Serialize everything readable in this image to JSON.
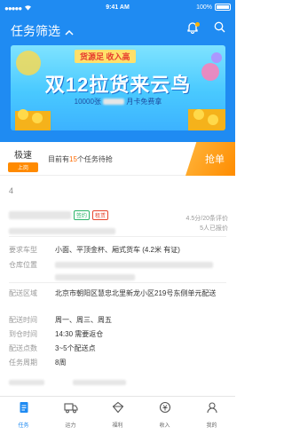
{
  "status_bar": {
    "time": "9:41 AM",
    "battery": "100%"
  },
  "header": {
    "title": "任务筛选"
  },
  "banner": {
    "tag": "货源足 收入高",
    "headline": "双12拉货来云鸟",
    "sub_left": "10000张",
    "sub_right": "月卡免费拿"
  },
  "notice": {
    "speed_title": "极速",
    "speed_tag": "上岗",
    "text_prefix": "目前有",
    "count": "15",
    "text_suffix": "个任务待抢",
    "grab_button": "抢单"
  },
  "list_count": "4",
  "task": {
    "tags": [
      "签约",
      "租赁"
    ],
    "rating_line": "4.5分/20条评价",
    "quote_line": "5人已报价",
    "rows": [
      {
        "label": "要求车型",
        "value": "小面、平顶金杯、厢式货车 (4.2米 有证)"
      },
      {
        "label": "仓库位置",
        "value": ""
      },
      {
        "label": "配送区域",
        "value": "北京市朝阳区慧忠北里新龙小区219号东侧单元配送"
      },
      {
        "label": "配送时间",
        "value": "周一、周三、周五"
      },
      {
        "label": "到仓时间",
        "value": "14:30 需要返仓"
      },
      {
        "label": "配送点数",
        "value": "3~5个配送点"
      },
      {
        "label": "任务周期",
        "value": "8周"
      }
    ]
  },
  "tabbar": {
    "items": [
      {
        "label": "任务",
        "icon": "task-icon"
      },
      {
        "label": "运力",
        "icon": "truck-icon"
      },
      {
        "label": "福利",
        "icon": "gift-icon"
      },
      {
        "label": "收入",
        "icon": "income-icon"
      },
      {
        "label": "我的",
        "icon": "profile-icon"
      }
    ]
  },
  "colors": {
    "primary": "#1f8bf2",
    "accent": "#ff8a00",
    "highlight": "#ff6a00"
  }
}
